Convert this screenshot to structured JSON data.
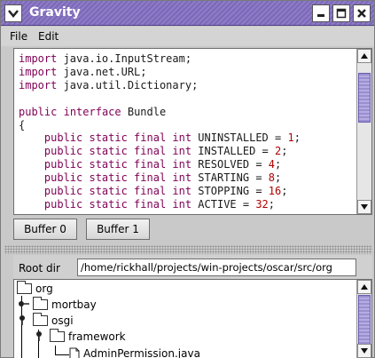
{
  "window": {
    "title": "Gravity"
  },
  "menu": {
    "file": "File",
    "edit": "Edit"
  },
  "editor": {
    "lines": [
      [
        {
          "t": "import",
          "c": "kw"
        },
        {
          "t": " java.io.InputStream;",
          "c": "plain"
        }
      ],
      [
        {
          "t": "import",
          "c": "kw"
        },
        {
          "t": " java.net.URL;",
          "c": "plain"
        }
      ],
      [
        {
          "t": "import",
          "c": "kw"
        },
        {
          "t": " java.util.Dictionary;",
          "c": "plain"
        }
      ],
      [],
      [
        {
          "t": "public",
          "c": "kw"
        },
        {
          "t": " ",
          "c": "plain"
        },
        {
          "t": "interface",
          "c": "kw"
        },
        {
          "t": " Bundle",
          "c": "plain"
        }
      ],
      [
        {
          "t": "{",
          "c": "plain"
        }
      ],
      [
        {
          "t": "    public static final int",
          "c": "kw"
        },
        {
          "t": " UNINSTALLED = ",
          "c": "plain"
        },
        {
          "t": "1",
          "c": "num"
        },
        {
          "t": ";",
          "c": "plain"
        }
      ],
      [
        {
          "t": "    public static final int",
          "c": "kw"
        },
        {
          "t": " INSTALLED = ",
          "c": "plain"
        },
        {
          "t": "2",
          "c": "num"
        },
        {
          "t": ";",
          "c": "plain"
        }
      ],
      [
        {
          "t": "    public static final int",
          "c": "kw"
        },
        {
          "t": " RESOLVED = ",
          "c": "plain"
        },
        {
          "t": "4",
          "c": "num"
        },
        {
          "t": ";",
          "c": "plain"
        }
      ],
      [
        {
          "t": "    public static final int",
          "c": "kw"
        },
        {
          "t": " STARTING = ",
          "c": "plain"
        },
        {
          "t": "8",
          "c": "num"
        },
        {
          "t": ";",
          "c": "plain"
        }
      ],
      [
        {
          "t": "    public static final int",
          "c": "kw"
        },
        {
          "t": " STOPPING = ",
          "c": "plain"
        },
        {
          "t": "16",
          "c": "num"
        },
        {
          "t": ";",
          "c": "plain"
        }
      ],
      [
        {
          "t": "    public static final int",
          "c": "kw"
        },
        {
          "t": " ACTIVE = ",
          "c": "plain"
        },
        {
          "t": "32",
          "c": "num"
        },
        {
          "t": ";",
          "c": "plain"
        }
      ]
    ]
  },
  "buffers": {
    "buffer0": "Buffer 0",
    "buffer1": "Buffer 1"
  },
  "rootdir": {
    "label": "Root dir",
    "value": "/home/rickhall/projects/win-projects/oscar/src/org"
  },
  "tree": {
    "org": "org",
    "mortbay": "mortbay",
    "osgi": "osgi",
    "framework": "framework",
    "admin_permission": "AdminPermission.java"
  },
  "colors": {
    "titlebar": "#7c68b8",
    "keyword": "#7f0055",
    "number": "#b00000"
  }
}
